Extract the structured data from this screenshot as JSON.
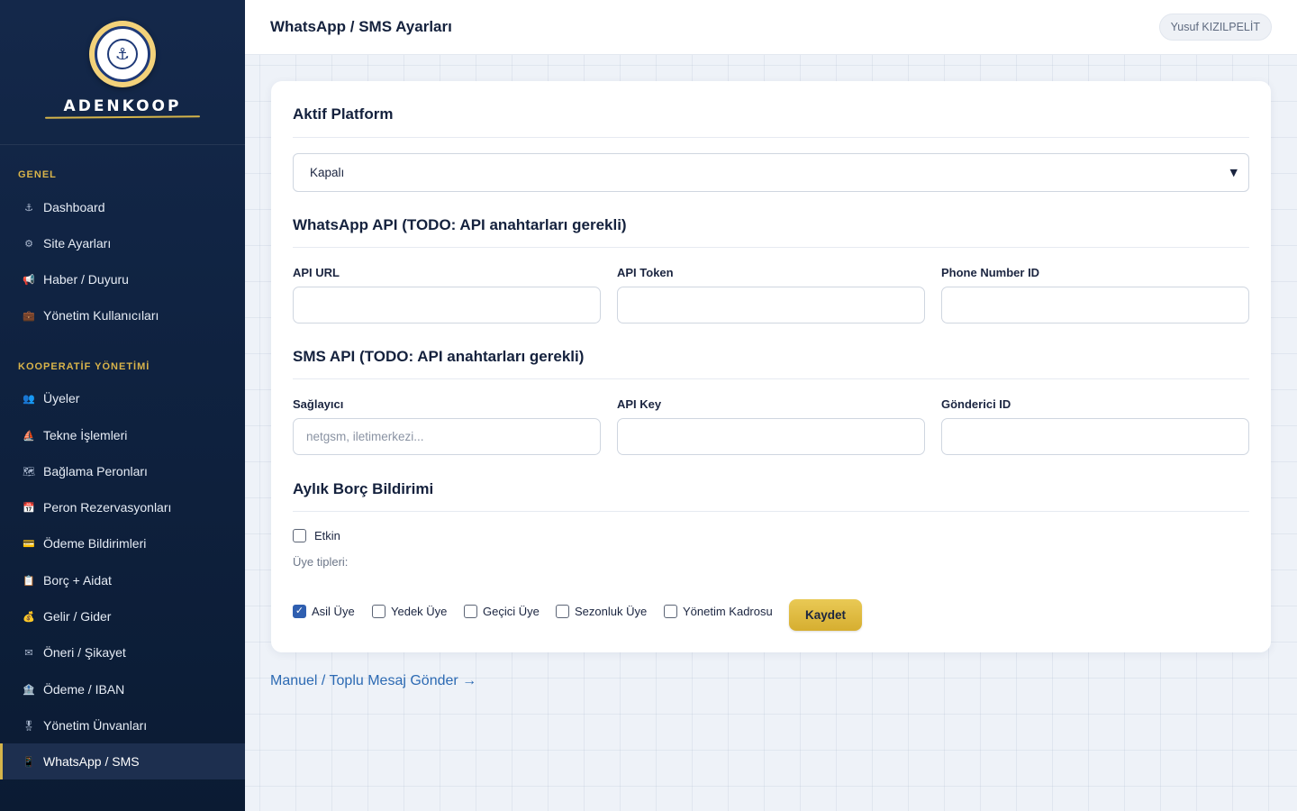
{
  "brand": {
    "name": "ADENKOOP"
  },
  "sidebar": {
    "sections": [
      {
        "title": "GENEL",
        "items": [
          {
            "label": "Dashboard",
            "icon": "anchor-icon",
            "glyph": "⚓"
          },
          {
            "label": "Site Ayarları",
            "icon": "gear-icon",
            "glyph": "⚙"
          },
          {
            "label": "Haber / Duyuru",
            "icon": "megaphone-icon",
            "glyph": "📢"
          },
          {
            "label": "Yönetim Kullanıcıları",
            "icon": "briefcase-icon",
            "glyph": "💼"
          }
        ]
      },
      {
        "title": "KOOPERATİF YÖNETİMİ",
        "items": [
          {
            "label": "Üyeler",
            "icon": "people-icon",
            "glyph": "👥"
          },
          {
            "label": "Tekne İşlemleri",
            "icon": "sailboat-icon",
            "glyph": "⛵"
          },
          {
            "label": "Bağlama Peronları",
            "icon": "map-icon",
            "glyph": "🗺"
          },
          {
            "label": "Peron Rezervasyonları",
            "icon": "calendar-icon",
            "glyph": "📅"
          },
          {
            "label": "Ödeme Bildirimleri",
            "icon": "card-icon",
            "glyph": "💳"
          },
          {
            "label": "Borç + Aidat",
            "icon": "clipboard-icon",
            "glyph": "📋"
          },
          {
            "label": "Gelir / Gider",
            "icon": "money-bag-icon",
            "glyph": "💰"
          },
          {
            "label": "Öneri / Şikayet",
            "icon": "envelope-icon",
            "glyph": "✉"
          },
          {
            "label": "Ödeme / IBAN",
            "icon": "bank-icon",
            "glyph": "🏦"
          },
          {
            "label": "Yönetim Ünvanları",
            "icon": "medal-icon",
            "glyph": "🎖"
          },
          {
            "label": "WhatsApp / SMS",
            "icon": "mobile-icon",
            "glyph": "📱",
            "active": true
          }
        ]
      }
    ]
  },
  "topbar": {
    "title": "WhatsApp / SMS Ayarları",
    "user": "Yusuf KIZILPELİT"
  },
  "platform": {
    "title": "Aktif Platform",
    "selected": "Kapalı"
  },
  "whatsapp": {
    "title": "WhatsApp API (TODO: API anahtarları gerekli)",
    "fields": [
      {
        "label": "API URL",
        "value": "",
        "placeholder": ""
      },
      {
        "label": "API Token",
        "value": "",
        "placeholder": ""
      },
      {
        "label": "Phone Number ID",
        "value": "",
        "placeholder": ""
      }
    ]
  },
  "sms": {
    "title": "SMS API (TODO: API anahtarları gerekli)",
    "fields": [
      {
        "label": "Sağlayıcı",
        "value": "",
        "placeholder": "netgsm, iletimerkezi..."
      },
      {
        "label": "API Key",
        "value": "",
        "placeholder": ""
      },
      {
        "label": "Gönderici ID",
        "value": "",
        "placeholder": ""
      }
    ]
  },
  "debt": {
    "title": "Aylık Borç Bildirimi",
    "enabled_label": "Etkin",
    "enabled": false,
    "types_label": "Üye tipleri:",
    "types": [
      {
        "label": "Asil Üye",
        "checked": true
      },
      {
        "label": "Yedek Üye",
        "checked": false
      },
      {
        "label": "Geçici Üye",
        "checked": false
      },
      {
        "label": "Sezonluk Üye",
        "checked": false
      },
      {
        "label": "Yönetim Kadrosu",
        "checked": false
      }
    ],
    "save_label": "Kaydet"
  },
  "manual_link": "Manuel / Toplu Mesaj Gönder →"
}
